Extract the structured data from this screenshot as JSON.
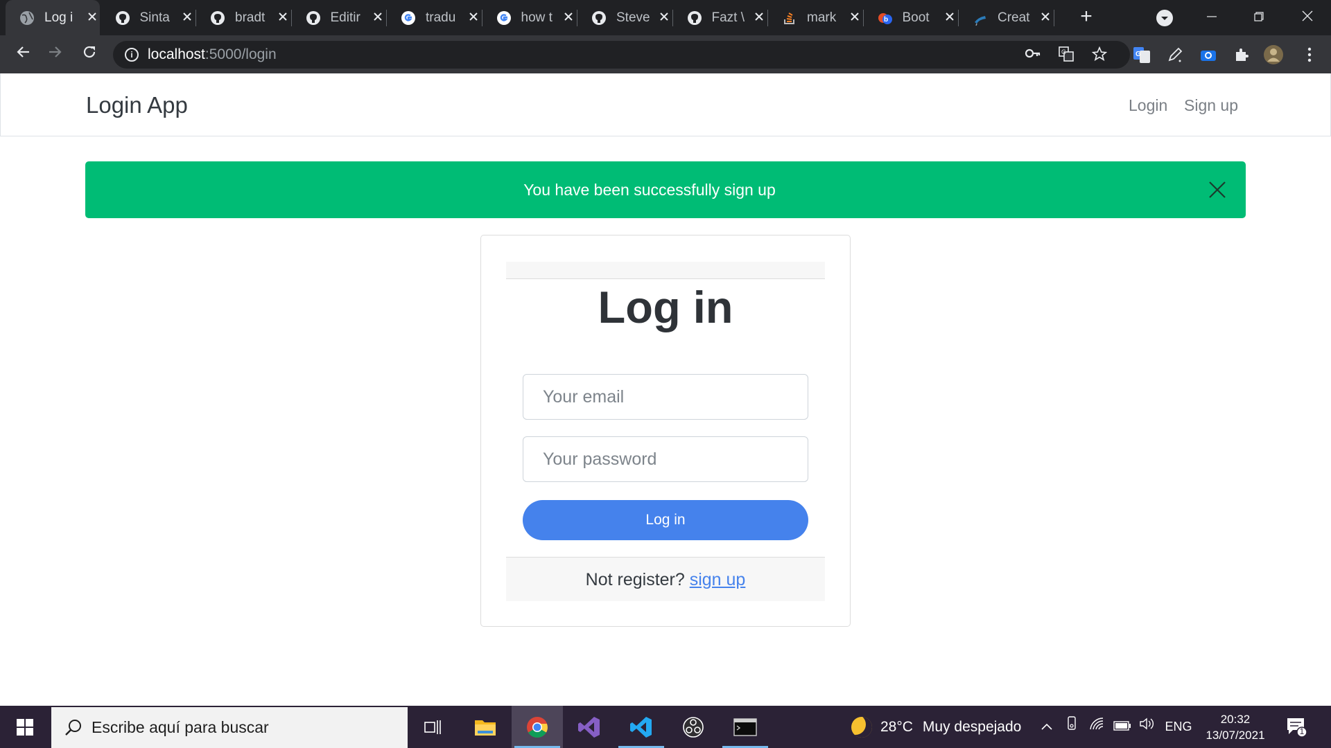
{
  "browser": {
    "tabs": [
      {
        "title": "Log i",
        "favicon": "globe-icon",
        "active": true
      },
      {
        "title": "Sinta",
        "favicon": "github-icon"
      },
      {
        "title": "bradt",
        "favicon": "github-icon"
      },
      {
        "title": "Editir",
        "favicon": "github-icon"
      },
      {
        "title": "tradu",
        "favicon": "google-icon"
      },
      {
        "title": "how t",
        "favicon": "google-icon"
      },
      {
        "title": "Steve",
        "favicon": "github-icon"
      },
      {
        "title": "Fazt \\",
        "favicon": "github-icon"
      },
      {
        "title": "mark",
        "favicon": "stackoverflow-icon"
      },
      {
        "title": "Boot",
        "favicon": "bootstrap-icon"
      },
      {
        "title": "Creat",
        "favicon": "flask-icon"
      }
    ],
    "new_tab": "+",
    "url_host": "localhost",
    "url_path": ":5000/login"
  },
  "app": {
    "brand": "Login App",
    "nav_login": "Login",
    "nav_signup": "Sign up",
    "alert_message": "You have been successfully sign up",
    "login_title": "Log in",
    "email_placeholder": "Your email",
    "password_placeholder": "Your password",
    "submit_label": "Log in",
    "footer_text": "Not register? ",
    "footer_link": "sign up",
    "colors": {
      "alert": "#00bc75",
      "primary": "#4582ec"
    }
  },
  "taskbar": {
    "search_placeholder": "Escribe aquí para buscar",
    "weather_temp": "28°C",
    "weather_desc": "Muy despejado",
    "language": "ENG",
    "time": "20:32",
    "date": "13/07/2021",
    "notification_count": "1"
  }
}
